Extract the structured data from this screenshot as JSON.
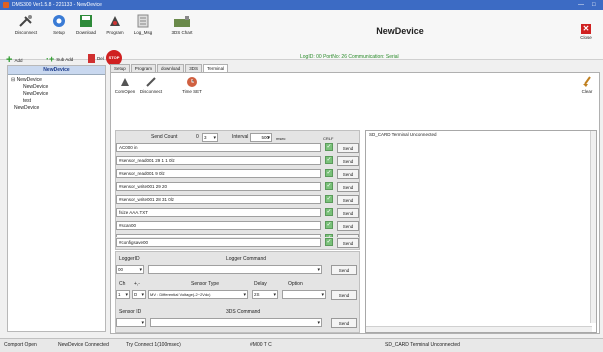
{
  "window": {
    "title": "DMS300 Ver1.5.8 - 221133 - NewDevice",
    "controls": [
      "—",
      "□"
    ]
  },
  "toolbar": {
    "buttons": [
      {
        "label": "Disconnect",
        "icon": "disconnect-icon"
      },
      {
        "label": "Setup",
        "icon": "setup-icon"
      },
      {
        "label": "Download",
        "icon": "download-icon"
      },
      {
        "label": "Program",
        "icon": "program-icon"
      },
      {
        "label": "Log_Msg",
        "icon": "log-icon"
      },
      {
        "label": "3DS Chart",
        "icon": "chart-icon"
      }
    ],
    "add": "Add",
    "sub_add": "Sub Add",
    "del": "Del",
    "stop": "STOP",
    "device_title": "NewDevice",
    "close": "Close",
    "close_symbol": "✕",
    "status_info": "LogID: 00  PortNo: 26  Communication: Serial"
  },
  "left_panel": {
    "header": "NewDevice",
    "tree": [
      {
        "label": "NewDevice",
        "prefix": "⊟",
        "level": 0
      },
      {
        "label": "NewDevice",
        "prefix": "",
        "level": 1
      },
      {
        "label": "NewDevice",
        "prefix": "",
        "level": 1
      },
      {
        "label": "test",
        "prefix": "",
        "level": 1
      },
      {
        "label": "NewDevice",
        "prefix": "",
        "level": 0
      }
    ]
  },
  "tabs": [
    "Setup",
    "Program",
    "download",
    "3DS",
    "Terminal"
  ],
  "active_tab": "Terminal",
  "subtoolbar": {
    "comopen": "ComOpen",
    "disconnect": "Disconnect",
    "time_set": "Time SET",
    "clear": "Clear"
  },
  "send_count": {
    "label": "Send Count",
    "value1": "0",
    "value2": "3",
    "interval_label": "Interval",
    "interval_value": "500",
    "unit": "msec",
    "crlf": "CRLF"
  },
  "commands": [
    "AC000 in",
    "#sensor_read001 29 1 1 0lz",
    "#sensor_read001 9 0lz",
    "#sensor_write001 29 20",
    "#sensor_write001 28 31 0lz",
    "fsize AAA.TXT",
    "#scan00",
    "#power00 on",
    "#configsave00"
  ],
  "send_label": "Send",
  "check_mark": "✓",
  "logger": {
    "logger_id_label": "LoggerID",
    "logger_command_label": "Logger Command",
    "logger_id_value": "00",
    "ch_label": "Ch",
    "sign_label": "+,-",
    "sensor_type_label": "Sensor Type",
    "delay_label": "Delay",
    "option_label": "Option",
    "ch_value": "1",
    "sign_value": "D",
    "sensor_type_value": "MV : Differential Voltage(-2~2Vdc)",
    "delay_value": "2S",
    "sensor_id_label": "Sensor ID",
    "sds_command_label": "3DS Command"
  },
  "terminal": {
    "header": "SD_CARD Terminal Unconnected"
  },
  "statusbar": {
    "port": "Comport Open",
    "device": "NewDevice Connected",
    "try": "Try Connect 1(100msec)",
    "cmd": "#M00 T C",
    "terminal": "SD_CARD Terminal Unconnected"
  },
  "colors": {
    "title_bar": "#3c6bc4",
    "accent_green": "#2a8a2a",
    "stop_red": "#d02020",
    "checkbox_green": "#7ac17a"
  }
}
